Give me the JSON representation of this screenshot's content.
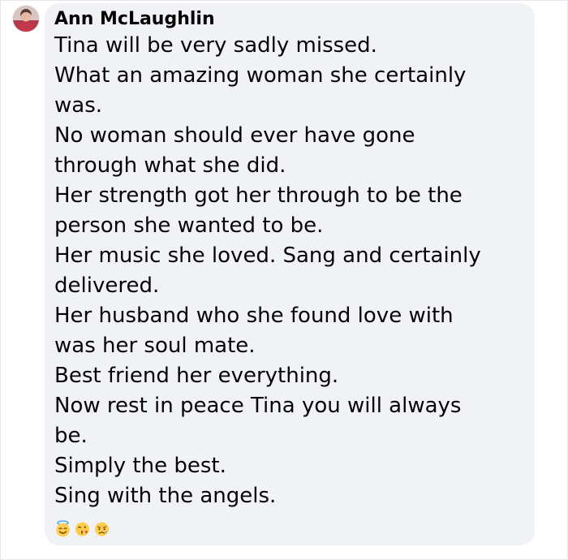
{
  "comment": {
    "author": "Ann McLaughlin",
    "lines": [
      "Tina will be very sadly missed.",
      "What an amazing woman she certainly",
      "was.",
      "No woman should ever have gone",
      "through what she did.",
      "Her strength got her through to be the",
      "person she wanted to be.",
      "Her music she loved. Sang and certainly",
      "delivered.",
      "Her husband who she found love with",
      "was her soul mate.",
      "Best friend her everything.",
      "Now rest in peace Tina you will always",
      "be.",
      "Simply the best.",
      "Sing with the angels."
    ],
    "emojis": [
      "smiling-face-with-halo",
      "face-blowing-a-kiss",
      "sad-but-relieved-face"
    ]
  },
  "colors": {
    "bubble": "#f0f2f5",
    "text": "#050505",
    "emoji_yellow": "#ffcc4d"
  }
}
